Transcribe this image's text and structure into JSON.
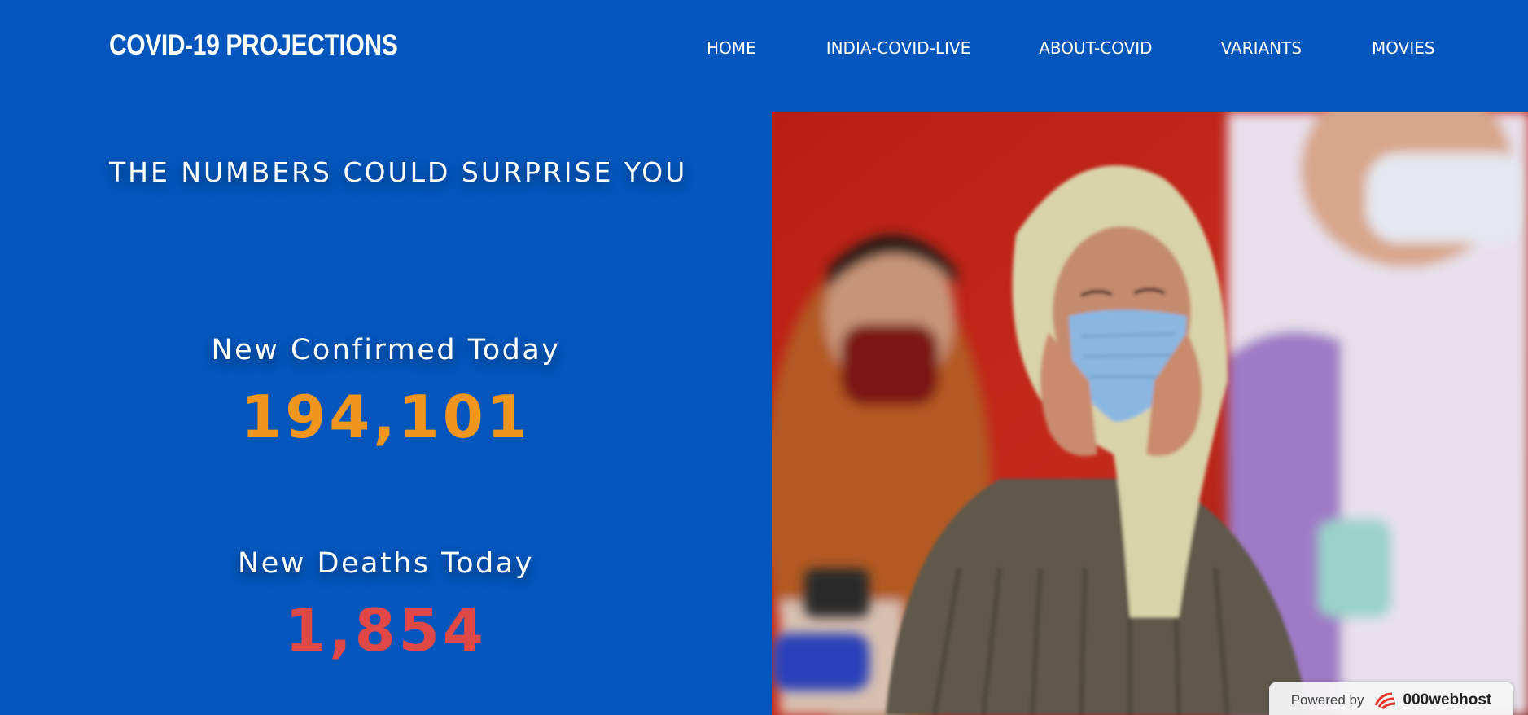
{
  "header": {
    "brand": "COVID-19 PROJECTIONS",
    "nav": [
      {
        "label": "HOME"
      },
      {
        "label": "INDIA-COVID-LIVE"
      },
      {
        "label": "ABOUT-COVID"
      },
      {
        "label": "VARIANTS"
      },
      {
        "label": "MOVIES"
      }
    ]
  },
  "main": {
    "tagline": "THE NUMBERS COULD SURPRISE YOU",
    "confirmed": {
      "label": "New Confirmed Today",
      "value": "194,101"
    },
    "deaths": {
      "label": "New Deaths Today",
      "value": "1,854"
    }
  },
  "badge": {
    "powered_by": "Powered by",
    "brand": "000webhost",
    "icon": "000webhost-logo-icon"
  },
  "colors": {
    "background": "#0356bb",
    "confirmed": "#f0961e",
    "deaths": "#e04848",
    "text": "#ffffff"
  }
}
